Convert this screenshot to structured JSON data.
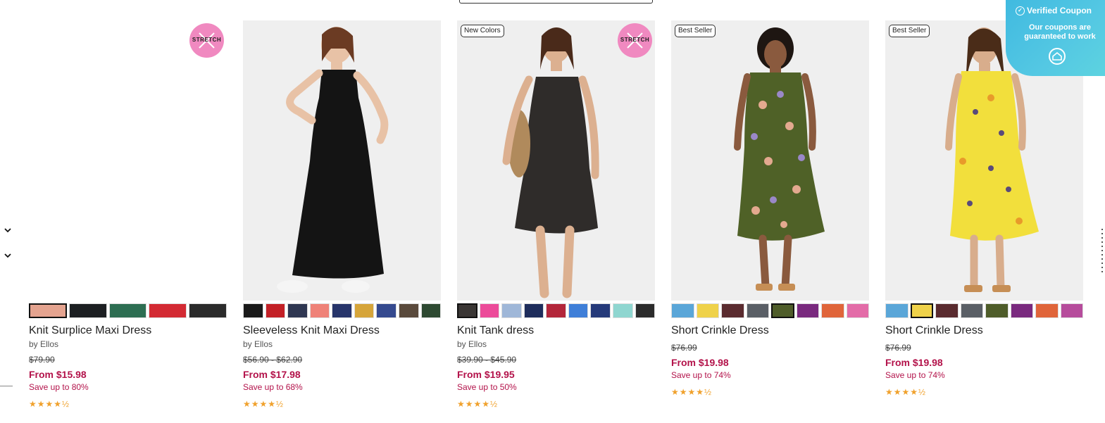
{
  "coupon": {
    "title": "Verified Coupon",
    "subtitle": "Our coupons are guaranteed to work",
    "icon": "check-circle-icon"
  },
  "filters": {
    "icons": [
      "chevron-down-icon",
      "chevron-down-icon"
    ]
  },
  "products": [
    {
      "name": "Knit Surplice Maxi Dress",
      "brand": "by Ellos",
      "original_price": "$79.90",
      "price": "From $15.98",
      "save": "Save up to 80%",
      "badge": "",
      "stretch": "STRETCH",
      "rating": "★★★★½",
      "swatches": [
        "#e4a38f",
        "#1c1f22",
        "#2d6e52",
        "#d32a33",
        "#2b2b2b"
      ],
      "selected_swatch": 0
    },
    {
      "name": "Sleeveless Knit Maxi Dress",
      "brand": "by Ellos",
      "original_price": "$56.90 - $62.90",
      "price": "From $17.98",
      "save": "Save up to 68%",
      "badge": "",
      "stretch": "",
      "rating": "★★★★½",
      "swatches": [
        "#1a1a1a",
        "#c32026",
        "#2f3752",
        "#ef8278",
        "#27356b",
        "#d6a53a",
        "#354a8f",
        "#5a4a3c",
        "#2e4a32"
      ],
      "selected_swatch": -1
    },
    {
      "name": "Knit Tank dress",
      "brand": "by Ellos",
      "original_price": "$39.90 - $45.90",
      "price": "From $19.95",
      "save": "Save up to 50%",
      "badge": "New Colors",
      "stretch": "STRETCH",
      "rating": "★★★★½",
      "swatches": [
        "#3a3634",
        "#ec4b9a",
        "#9fb7d8",
        "#1e2d5c",
        "#b3263a",
        "#3f7fd8",
        "#253a7a",
        "#8fd6d0",
        "#2c2c2c"
      ],
      "selected_swatch": 0
    },
    {
      "name": "Short Crinkle Dress",
      "brand": "",
      "original_price": "$76.99",
      "price": "From $19.98",
      "save": "Save up to 74%",
      "badge": "Best Seller",
      "stretch": "",
      "rating": "★★★★½",
      "swatches": [
        "#5aa6d8",
        "#efd24a",
        "#5a2b2f",
        "#5a5f66",
        "#4f5d2a",
        "#7a2a7f",
        "#e0653a",
        "#e36ca8"
      ],
      "selected_swatch": 4
    },
    {
      "name": "Short Crinkle Dress",
      "brand": "",
      "original_price": "$76.99",
      "price": "From $19.98",
      "save": "Save up to 74%",
      "badge": "Best Seller",
      "stretch": "",
      "rating": "★★★★½",
      "swatches": [
        "#5aa6d8",
        "#efd24a",
        "#5a2b2f",
        "#5a5f66",
        "#4f5d2a",
        "#7a2a7f",
        "#e0653a",
        "#b64c9c"
      ],
      "selected_swatch": 1
    }
  ]
}
